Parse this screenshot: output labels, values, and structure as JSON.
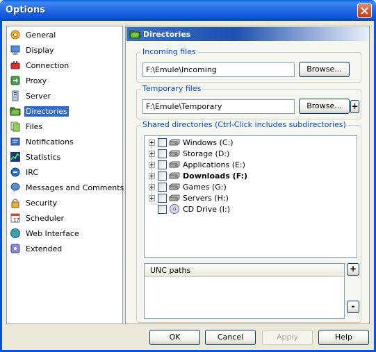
{
  "window": {
    "title": "Options"
  },
  "sidebar": {
    "items": [
      {
        "label": "General",
        "icon": "gear-icon"
      },
      {
        "label": "Display",
        "icon": "monitor-icon"
      },
      {
        "label": "Connection",
        "icon": "connection-icon"
      },
      {
        "label": "Proxy",
        "icon": "proxy-icon"
      },
      {
        "label": "Server",
        "icon": "server-icon"
      },
      {
        "label": "Directories",
        "icon": "folder-icon",
        "selected": true
      },
      {
        "label": "Files",
        "icon": "files-icon"
      },
      {
        "label": "Notifications",
        "icon": "notifications-icon"
      },
      {
        "label": "Statistics",
        "icon": "statistics-icon"
      },
      {
        "label": "IRC",
        "icon": "irc-icon"
      },
      {
        "label": "Messages and Comments",
        "icon": "messages-icon"
      },
      {
        "label": "Security",
        "icon": "lock-icon"
      },
      {
        "label": "Scheduler",
        "icon": "calendar-icon"
      },
      {
        "label": "Web Interface",
        "icon": "globe-icon"
      },
      {
        "label": "Extended",
        "icon": "extended-icon"
      }
    ]
  },
  "panel": {
    "title": "Directories",
    "incoming": {
      "label": "Incoming files",
      "value": "F:\\Emule\\Incoming",
      "browse": "Browse..."
    },
    "temporary": {
      "label": "Temporary files",
      "value": "F:\\Emule\\Temporary",
      "browse": "Browse...",
      "add": "+"
    },
    "shared": {
      "label": "Shared directories (Ctrl-Click includes subdirectories)",
      "drives": [
        {
          "label": "Windows  (C:)",
          "bold": false,
          "expandable": true,
          "icon": "hard-drive-icon"
        },
        {
          "label": "Storage  (D:)",
          "bold": false,
          "expandable": true,
          "icon": "hard-drive-icon"
        },
        {
          "label": "Applications (E:)",
          "bold": false,
          "expandable": true,
          "icon": "hard-drive-icon"
        },
        {
          "label": "Downloads (F:)",
          "bold": true,
          "expandable": true,
          "icon": "hard-drive-icon"
        },
        {
          "label": "Games (G:)",
          "bold": false,
          "expandable": true,
          "icon": "hard-drive-icon"
        },
        {
          "label": "Servers (H:)",
          "bold": false,
          "expandable": true,
          "icon": "hard-drive-icon"
        },
        {
          "label": "CD Drive (I:)",
          "bold": false,
          "expandable": false,
          "icon": "cd-drive-icon"
        }
      ],
      "unc_header": "UNC paths",
      "unc_add": "+",
      "unc_remove": "-"
    }
  },
  "buttons": {
    "ok": "OK",
    "cancel": "Cancel",
    "apply": "Apply",
    "help": "Help"
  }
}
